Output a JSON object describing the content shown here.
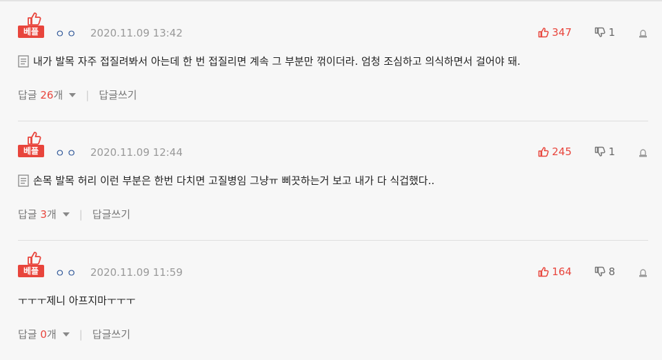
{
  "labels": {
    "best_badge": "베플",
    "reply_prefix": "답글",
    "reply_suffix": "개",
    "write_reply": "답글쓰기",
    "separator": "|"
  },
  "colors": {
    "accent": "#e8453c",
    "nickname": "#335a9a",
    "muted": "#999999"
  },
  "comments": [
    {
      "nickname": "ㅇㅇ",
      "date": "2020.11.09 13:42",
      "up_count": "347",
      "down_count": "1",
      "text": "내가 발목 자주 접질려봐서 아는데 한 번 접질리면 계속 그 부분만 꺾이더라. 엄청 조심하고 의식하면서 걸어야 돼.",
      "reply_count": "26",
      "has_memo_icon": true
    },
    {
      "nickname": "ㅇㅇ",
      "date": "2020.11.09 12:44",
      "up_count": "245",
      "down_count": "1",
      "text": "손목 발목 허리 이런 부분은 한번 다치면 고질병임 그냥ㅠ 삐끗하는거 보고 내가 다 식겁했다..",
      "reply_count": "3",
      "has_memo_icon": true
    },
    {
      "nickname": "ㅇㅇ",
      "date": "2020.11.09 11:59",
      "up_count": "164",
      "down_count": "8",
      "text": "ㅜㅜㅜ제니 아프지마ㅜㅜㅜ",
      "reply_count": "0",
      "has_memo_icon": false
    }
  ]
}
